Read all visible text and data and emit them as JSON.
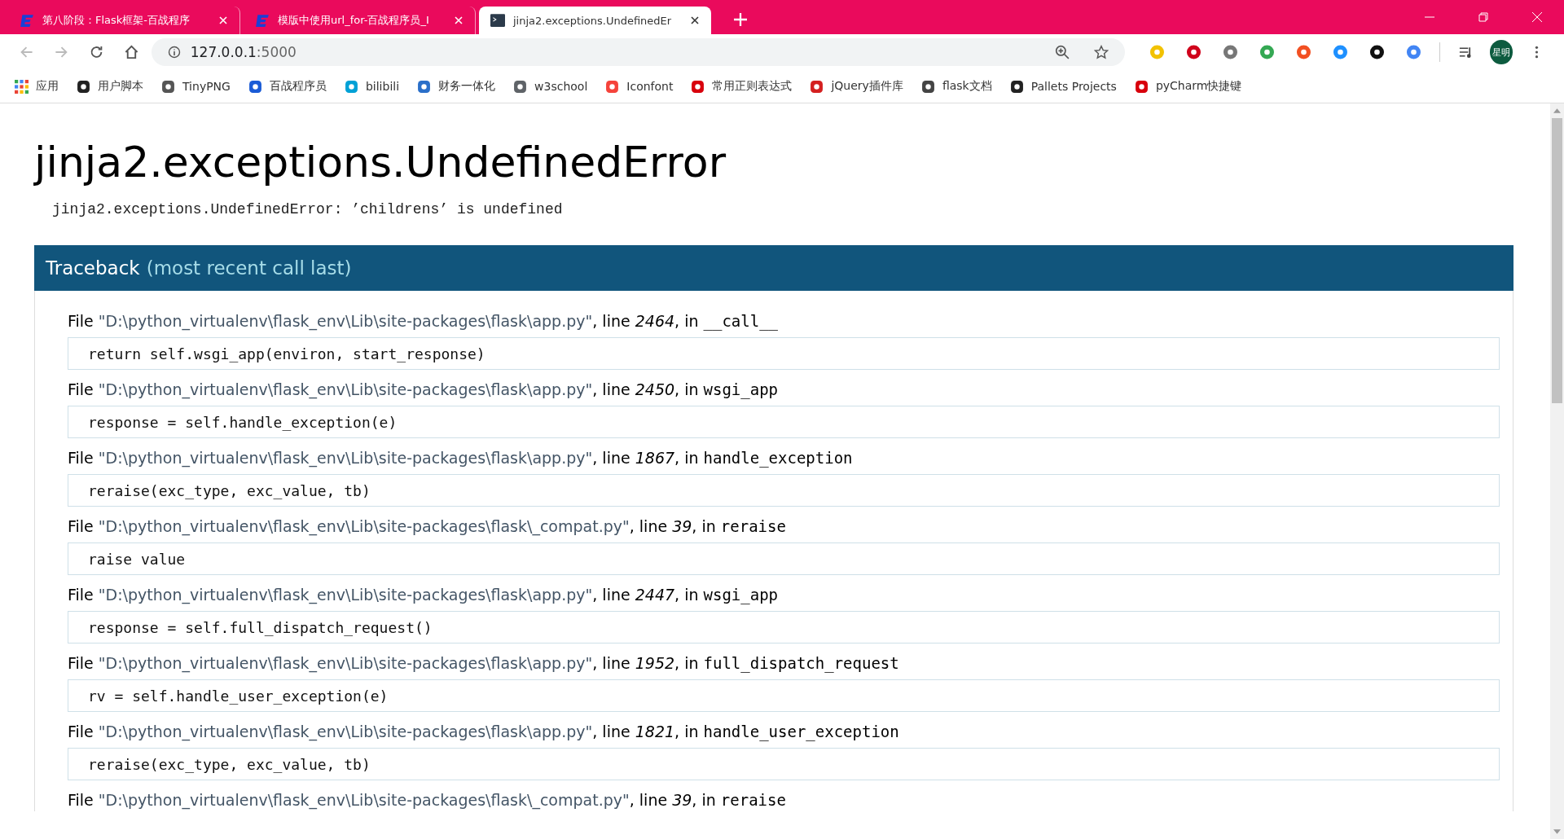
{
  "tabs": [
    {
      "title": "第八阶段：Flask框架-百战程序",
      "selected": false
    },
    {
      "title": "模版中使用url_for-百战程序员_I",
      "selected": false
    },
    {
      "title": "jinja2.exceptions.UndefinedEr",
      "selected": true
    }
  ],
  "address": {
    "host": "127.0.0.1",
    "port": ":5000"
  },
  "profile": "星明",
  "bookmarks": [
    "应用",
    "用户脚本",
    "TinyPNG",
    "百战程序员",
    "bilibili",
    "财务一体化",
    "w3school",
    "Iconfont",
    "常用正则表达式",
    "jQuery插件库",
    "flask文档",
    "Pallets Projects",
    "pyCharm快捷键"
  ],
  "error": {
    "title": "jinja2.exceptions.UndefinedError",
    "message": "jinja2.exceptions.UndefinedError: ’childrens’ is undefined"
  },
  "traceback": {
    "title": "Traceback",
    "subtitle": "(most recent call last)"
  },
  "frames": [
    {
      "file_label": "File",
      "path": "\"D:\\python_virtualenv\\flask_env\\Lib\\site-packages\\flask\\app.py\"",
      "line_label": ", line",
      "line": "2464",
      "in_label": ", in",
      "function": "__call__",
      "code": "return self.wsgi_app(environ, start_response)"
    },
    {
      "file_label": "File",
      "path": "\"D:\\python_virtualenv\\flask_env\\Lib\\site-packages\\flask\\app.py\"",
      "line_label": ", line",
      "line": "2450",
      "in_label": ", in",
      "function": "wsgi_app",
      "code": "response = self.handle_exception(e)"
    },
    {
      "file_label": "File",
      "path": "\"D:\\python_virtualenv\\flask_env\\Lib\\site-packages\\flask\\app.py\"",
      "line_label": ", line",
      "line": "1867",
      "in_label": ", in",
      "function": "handle_exception",
      "code": "reraise(exc_type, exc_value, tb)"
    },
    {
      "file_label": "File",
      "path": "\"D:\\python_virtualenv\\flask_env\\Lib\\site-packages\\flask\\_compat.py\"",
      "line_label": ", line",
      "line": "39",
      "in_label": ", in",
      "function": "reraise",
      "code": "raise value"
    },
    {
      "file_label": "File",
      "path": "\"D:\\python_virtualenv\\flask_env\\Lib\\site-packages\\flask\\app.py\"",
      "line_label": ", line",
      "line": "2447",
      "in_label": ", in",
      "function": "wsgi_app",
      "code": "response = self.full_dispatch_request()"
    },
    {
      "file_label": "File",
      "path": "\"D:\\python_virtualenv\\flask_env\\Lib\\site-packages\\flask\\app.py\"",
      "line_label": ", line",
      "line": "1952",
      "in_label": ", in",
      "function": "full_dispatch_request",
      "code": "rv = self.handle_user_exception(e)"
    },
    {
      "file_label": "File",
      "path": "\"D:\\python_virtualenv\\flask_env\\Lib\\site-packages\\flask\\app.py\"",
      "line_label": ", line",
      "line": "1821",
      "in_label": ", in",
      "function": "handle_user_exception",
      "code": "reraise(exc_type, exc_value, tb)"
    },
    {
      "file_label": "File",
      "path": "\"D:\\python_virtualenv\\flask_env\\Lib\\site-packages\\flask\\_compat.py\"",
      "line_label": ", line",
      "line": "39",
      "in_label": ", in",
      "function": "reraise"
    }
  ]
}
